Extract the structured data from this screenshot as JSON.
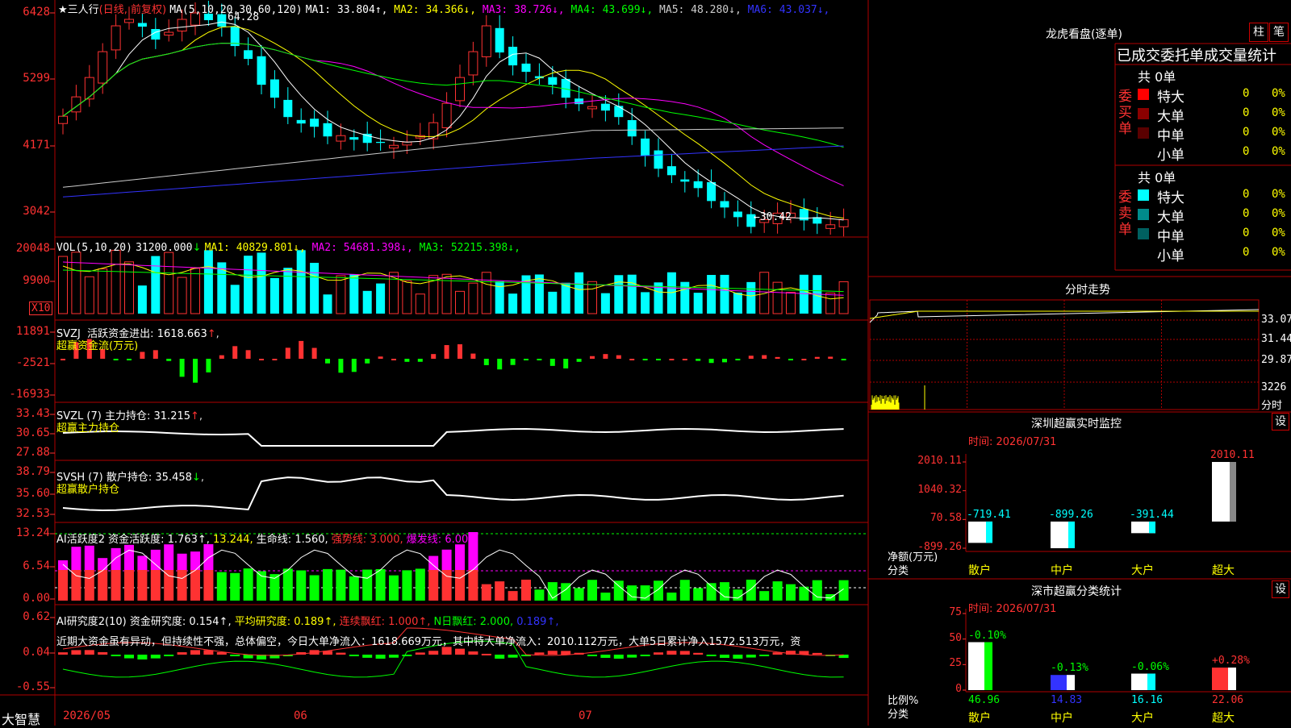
{
  "colors": {
    "red": "#ff3232",
    "cyan": "#00ffff",
    "green": "#00ff00",
    "yellow": "#ffff00",
    "magenta": "#ff00ff",
    "blue": "#3333ff",
    "white": "#ffffff",
    "grid": "#b00000",
    "textGray": "#dddddd"
  },
  "main": {
    "stock": "★三人行",
    "period": "(日线, 前复权)",
    "ma_params": "MA(5,10,20,30,60,120)",
    "ma": [
      {
        "label": "MA1:",
        "value": "33.804",
        "arrow": "↑",
        "color": "#ffffff"
      },
      {
        "label": "MA2:",
        "value": "34.366",
        "arrow": "↓",
        "color": "#ffff00"
      },
      {
        "label": "MA3:",
        "value": "38.726",
        "arrow": "↓",
        "color": "#ff00ff"
      },
      {
        "label": "MA4:",
        "value": "43.699",
        "arrow": "↓",
        "color": "#00ff00"
      },
      {
        "label": "MA5:",
        "value": "48.280",
        "arrow": "↓",
        "color": "#cccccc"
      },
      {
        "label": "MA6:",
        "value": "43.037",
        "arrow": "↓",
        "color": "#3333ff"
      }
    ],
    "y_labels": [
      "6428",
      "5299",
      "4171",
      "3042"
    ],
    "high_mark": "64.28",
    "low_mark": "←30.42"
  },
  "vol": {
    "title": "VOL(5,10,20)",
    "value": "31200.000",
    "arrow": "↓",
    "ma": [
      {
        "label": "MA1:",
        "value": "40829.801",
        "arrow": "↓",
        "color": "#ffff00"
      },
      {
        "label": "MA2:",
        "value": "54681.398",
        "arrow": "↓",
        "color": "#ff00ff"
      },
      {
        "label": "MA3:",
        "value": "52215.398",
        "arrow": "↓",
        "color": "#00ff00"
      }
    ],
    "y_labels": [
      "20048",
      "9900"
    ],
    "unit": "X10"
  },
  "svzj": {
    "title": "SVZJ",
    "label": "活跃资金进出:",
    "value": "1618.663",
    "arrow": "↑",
    "sub": "超赢资金流(万元)",
    "y_labels": [
      "11891",
      "-2521",
      "-16933"
    ]
  },
  "svzl": {
    "title": "SVZL (7)",
    "label": "主力持仓:",
    "value": "31.215",
    "arrow": "↑",
    "sub": "超赢主力持仓",
    "y_labels": [
      "33.43",
      "30.65",
      "27.88"
    ]
  },
  "svsh": {
    "title": "SVSH (7)",
    "label": "散户持仓:",
    "value": "35.458",
    "arrow": "↓",
    "sub": "超赢散户持仓",
    "y_labels": [
      "38.79",
      "35.60",
      "32.53"
    ]
  },
  "ai1": {
    "title": "AI活跃度2",
    "items": [
      {
        "label": "资金活跃度:",
        "value": "1.763",
        "arrow": "↑",
        "color": "#ffffff"
      },
      {
        "label": "",
        "value": "13.244",
        "arrow": "",
        "color": "#ffff00"
      },
      {
        "label": "生命线:",
        "value": "1.560",
        "arrow": "",
        "color": "#ffffff"
      },
      {
        "label": "强势线:",
        "value": "3.000",
        "arrow": "",
        "color": "#ff3232"
      },
      {
        "label": "爆发线:",
        "value": "6.000",
        "arrow": "",
        "color": "#ff00ff"
      }
    ],
    "y_labels": [
      "13.24",
      "6.54",
      "0.00"
    ]
  },
  "ai2": {
    "title": "AI研究度2(10)",
    "items": [
      {
        "label": "资金研究度:",
        "value": "0.154",
        "arrow": "↑",
        "color": "#ffffff"
      },
      {
        "label": "平均研究度:",
        "value": "0.189",
        "arrow": "↑",
        "color": "#ffff00"
      },
      {
        "label": "连续飘红:",
        "value": "1.000",
        "arrow": "↑",
        "color": "#ff3232"
      },
      {
        "label": "N日飘红:",
        "value": "2.000",
        "arrow": "",
        "color": "#00ff00"
      },
      {
        "label": "",
        "value": "0.189",
        "arrow": "↑",
        "color": "#3333ff"
      }
    ],
    "text": "近期大资金虽有异动，但持续性不强，总体偏空，今日大单净流入：1618.669万元，其中特大单净流入：2010.112万元，大单5日累计净入1572.513万元，资",
    "y_labels": [
      "0.62",
      "0.04",
      "-0.55"
    ]
  },
  "xaxis": {
    "labels": [
      "2026/05",
      "06",
      "07"
    ],
    "brand": "大智慧"
  },
  "dragon": {
    "title": "龙虎看盘(逐单)",
    "btn1": "柱",
    "btn2": "笔",
    "header": "已成交委托单成交量统计",
    "buy": {
      "side": "委买单",
      "total": "共 0单",
      "rows": [
        {
          "name": "特大",
          "count": "0",
          "pct": "0%",
          "color": "#ff0000"
        },
        {
          "name": "大单",
          "count": "0",
          "pct": "0%",
          "color": "#8b0000"
        },
        {
          "name": "中单",
          "count": "0",
          "pct": "0%",
          "color": "#5a0000"
        },
        {
          "name": "小单",
          "count": "0",
          "pct": "0%",
          "color": "#000000"
        }
      ]
    },
    "sell": {
      "side": "委卖单",
      "total": "共 0单",
      "rows": [
        {
          "name": "特大",
          "count": "0",
          "pct": "0%",
          "color": "#00ffff"
        },
        {
          "name": "大单",
          "count": "0",
          "pct": "0%",
          "color": "#008b8b"
        },
        {
          "name": "中单",
          "count": "0",
          "pct": "0%",
          "color": "#006060"
        },
        {
          "name": "小单",
          "count": "0",
          "pct": "0%",
          "color": "#000000"
        }
      ]
    }
  },
  "intraday": {
    "title": "分时走势",
    "y_labels": [
      "33.07",
      "31.44",
      "29.87",
      "3226"
    ],
    "unit": "分时"
  },
  "monitor": {
    "title": "深圳超赢实时监控",
    "btn": "设",
    "time": "时间: 2026/07/31",
    "y_labels": [
      "2010.11",
      "1040.32",
      "70.58",
      "-899.26"
    ],
    "ylabel": "净额(万元)",
    "xlabel": "分类",
    "cats": [
      "散户",
      "中户",
      "大户",
      "超大"
    ],
    "values": [
      "-719.41",
      "-899.26",
      "-391.44",
      "2010.11"
    ]
  },
  "stats": {
    "title": "深市超赢分类统计",
    "btn": "设",
    "time": "时间: 2026/07/31",
    "y_labels": [
      "75",
      "50",
      "25",
      "0"
    ],
    "ylabel": "比例%",
    "xlabel": "分类",
    "cats": [
      "散户",
      "中户",
      "大户",
      "超大"
    ],
    "values": [
      "46.96",
      "14.83",
      "16.16",
      "22.06"
    ],
    "deltas": [
      "-0.10%",
      "-0.13%",
      "-0.06%",
      "+0.28%"
    ]
  }
}
